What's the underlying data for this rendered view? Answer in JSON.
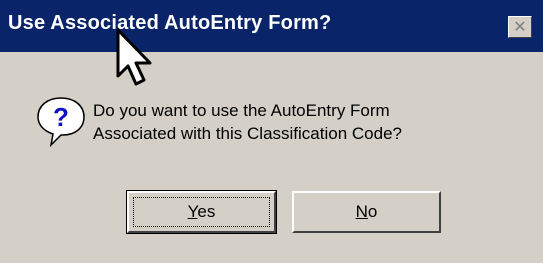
{
  "window": {
    "title": "Use Associated AutoEntry Form?",
    "close_glyph": "✕"
  },
  "message": {
    "line1": "Do you want to use the AutoEntry Form",
    "line2": "Associated with this Classification Code?"
  },
  "buttons": {
    "yes": {
      "mnemonic": "Y",
      "rest": "es"
    },
    "no": {
      "mnemonic": "N",
      "rest": "o"
    }
  },
  "icons": {
    "question": "question-icon",
    "cursor": "mouse-pointer-icon"
  },
  "colors": {
    "title_bar": "#0a246a",
    "dialog_face": "#d4d0c8",
    "question_icon": "#1010c8"
  }
}
